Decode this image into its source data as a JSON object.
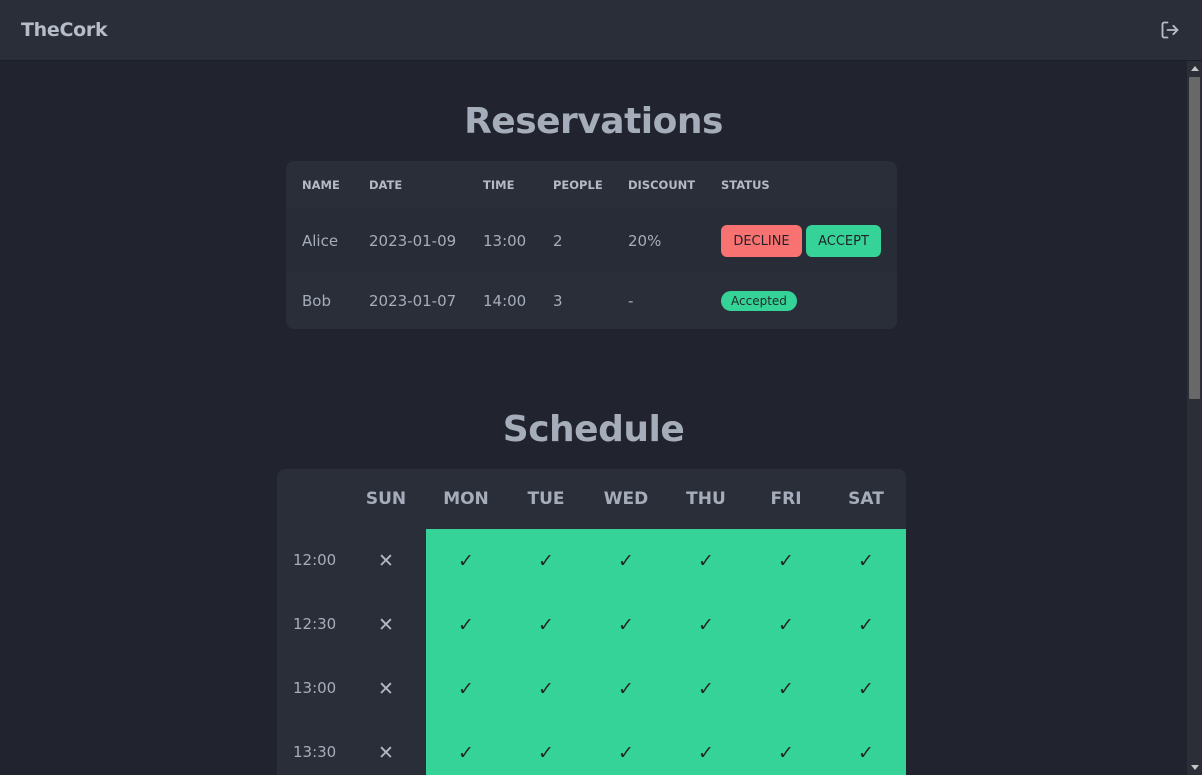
{
  "app": {
    "brand": "TheCork"
  },
  "reservations": {
    "title": "Reservations",
    "columns": [
      "NAME",
      "DATE",
      "TIME",
      "PEOPLE",
      "DISCOUNT",
      "STATUS"
    ],
    "rows": [
      {
        "name": "Alice",
        "date": "2023-01-09",
        "time": "13:00",
        "people": "2",
        "discount": "20%",
        "decline_label": "DECLINE",
        "accept_label": "ACCEPT"
      },
      {
        "name": "Bob",
        "date": "2023-01-07",
        "time": "14:00",
        "people": "3",
        "discount": "-",
        "status": "Accepted"
      }
    ]
  },
  "schedule": {
    "title": "Schedule",
    "days": [
      "SUN",
      "MON",
      "TUE",
      "WED",
      "THU",
      "FRI",
      "SAT"
    ],
    "symbols": {
      "on": "✓",
      "off": "✕"
    },
    "slots": [
      {
        "time": "12:00",
        "availability": [
          false,
          true,
          true,
          true,
          true,
          true,
          true
        ]
      },
      {
        "time": "12:30",
        "availability": [
          false,
          true,
          true,
          true,
          true,
          true,
          true
        ]
      },
      {
        "time": "13:00",
        "availability": [
          false,
          true,
          true,
          true,
          true,
          true,
          true
        ]
      },
      {
        "time": "13:30",
        "availability": [
          false,
          true,
          true,
          true,
          true,
          true,
          true
        ]
      }
    ]
  },
  "colors": {
    "accept": "#36d399",
    "decline": "#f87272",
    "background": "#21242e",
    "surface": "#2a2e39"
  },
  "icons": {
    "logout": "logout-icon"
  }
}
